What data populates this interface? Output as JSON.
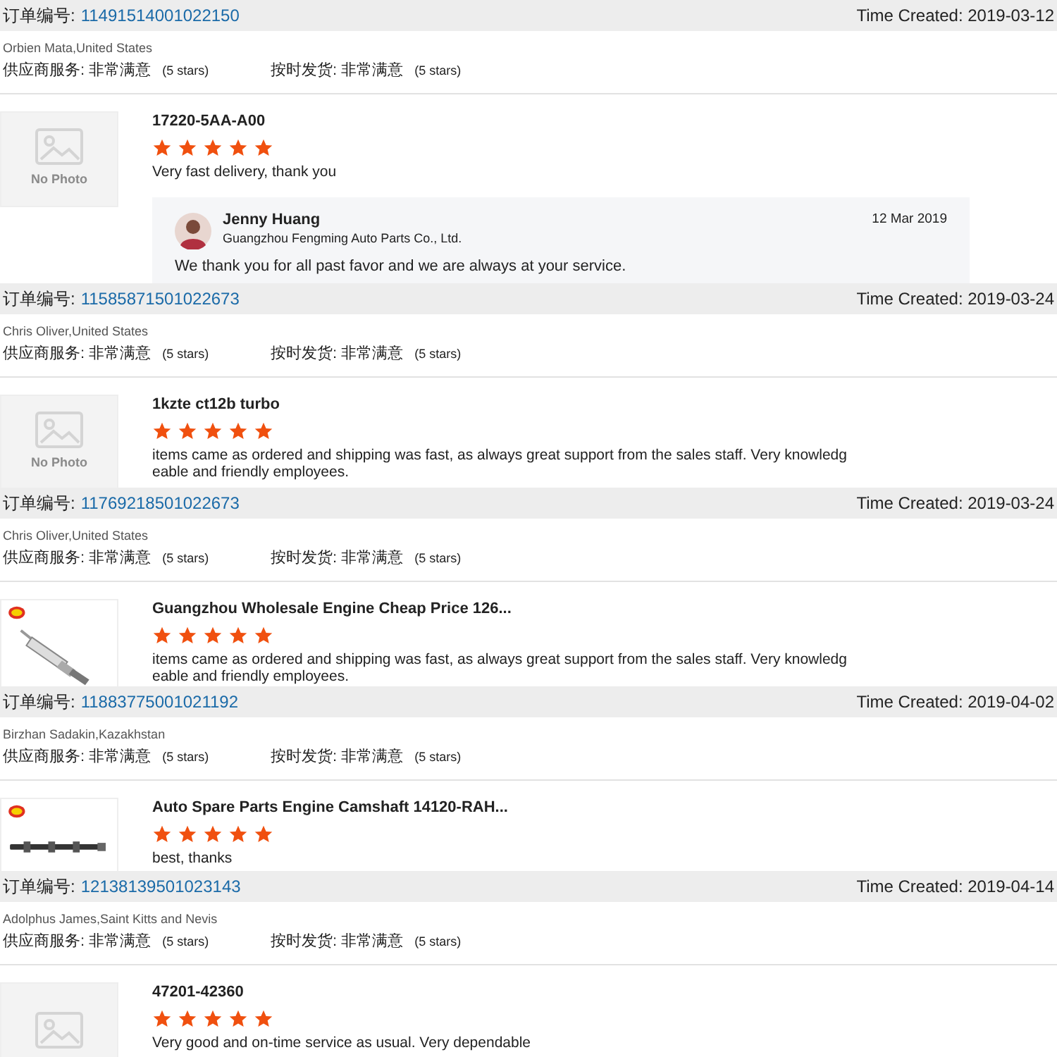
{
  "orders": [
    {
      "order_label": "订单编号:",
      "order_number": "11491514001022150",
      "time_created": "Time Created: 2019-03-12",
      "buyer": "Orbien Mata,United States",
      "ratings": [
        {
          "label": "供应商服务:",
          "value": "非常满意",
          "note": "(5 stars)"
        },
        {
          "label": "按时发货:",
          "value": "非常满意",
          "note": "(5 stars)"
        }
      ],
      "product": {
        "thumb": {
          "kind": "no-photo",
          "label": "No Photo"
        },
        "title": "17220-5AA-A00",
        "stars": 5,
        "comment_lines": [
          "Very fast delivery, thank you"
        ],
        "reply": {
          "name": "Jenny Huang",
          "company": "Guangzhou Fengming Auto Parts Co., Ltd.",
          "date": "12 Mar 2019",
          "text": "We thank you for all past favor and we are always at your service."
        }
      }
    },
    {
      "order_label": "订单编号:",
      "order_number": "11585871501022673",
      "time_created": "Time Created: 2019-03-24",
      "buyer": "Chris Oliver,United States",
      "ratings": [
        {
          "label": "供应商服务:",
          "value": "非常满意",
          "note": "(5 stars)"
        },
        {
          "label": "按时发货:",
          "value": "非常满意",
          "note": "(5 stars)"
        }
      ],
      "product": {
        "thumb": {
          "kind": "no-photo",
          "label": "No Photo"
        },
        "title": "1kzte ct12b turbo",
        "stars": 5,
        "comment_lines": [
          "items came as ordered and shipping was fast, as always great support from the sales staff. Very knowledg",
          "eable and friendly employees."
        ]
      }
    },
    {
      "order_label": "订单编号:",
      "order_number": "11769218501022673",
      "time_created": "Time Created: 2019-03-24",
      "buyer": "Chris Oliver,United States",
      "ratings": [
        {
          "label": "供应商服务:",
          "value": "非常满意",
          "note": "(5 stars)"
        },
        {
          "label": "按时发货:",
          "value": "非常满意",
          "note": "(5 stars)"
        }
      ],
      "product": {
        "thumb": {
          "kind": "picture"
        },
        "title": "Guangzhou Wholesale Engine Cheap Price 126...",
        "stars": 5,
        "comment_lines": [
          "items came as ordered and shipping was fast, as always great support from the sales staff. Very knowledg",
          "eable and friendly employees."
        ]
      }
    },
    {
      "order_label": "订单编号:",
      "order_number": "11883775001021192",
      "time_created": "Time Created: 2019-04-02",
      "buyer": "Birzhan Sadakin,Kazakhstan",
      "ratings": [
        {
          "label": "供应商服务:",
          "value": "非常满意",
          "note": "(5 stars)"
        },
        {
          "label": "按时发货:",
          "value": "非常满意",
          "note": "(5 stars)"
        }
      ],
      "product": {
        "thumb": {
          "kind": "picture"
        },
        "title": "Auto Spare Parts Engine Camshaft 14120-RAH...",
        "stars": 5,
        "comment_lines": [
          "best, thanks"
        ]
      }
    },
    {
      "order_label": "订单编号:",
      "order_number": "12138139501023143",
      "time_created": "Time Created: 2019-04-14",
      "buyer": "Adolphus James,Saint Kitts and Nevis",
      "ratings": [
        {
          "label": "供应商服务:",
          "value": "非常满意",
          "note": "(5 stars)"
        },
        {
          "label": "按时发货:",
          "value": "非常满意",
          "note": "(5 stars)"
        }
      ],
      "product": {
        "thumb": {
          "kind": "no-photo"
        },
        "title": "47201-42360",
        "stars": 5,
        "comment_lines": [
          "Very good and on-time service as usual. Very dependable"
        ]
      }
    }
  ]
}
